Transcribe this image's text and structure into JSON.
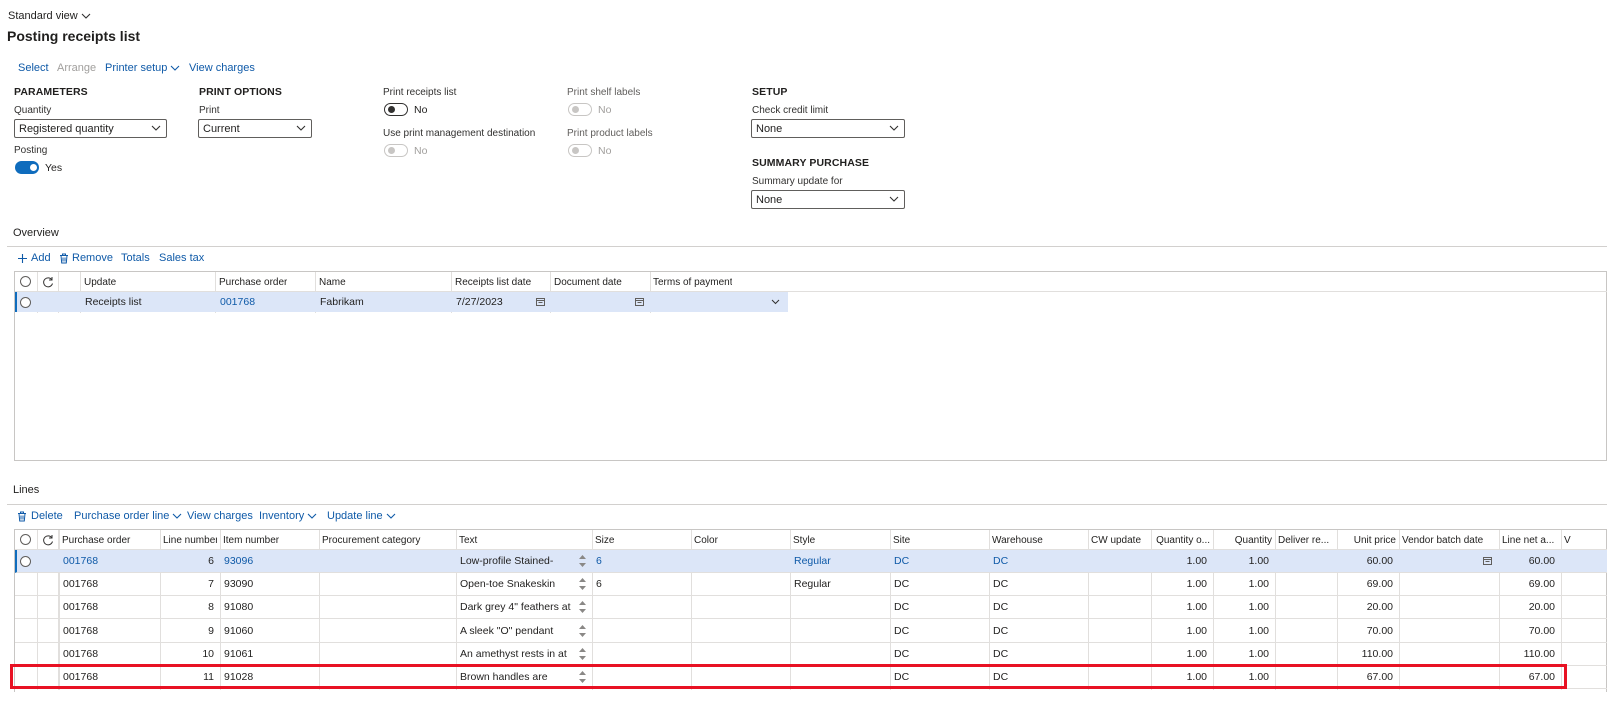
{
  "view": {
    "label": "Standard view"
  },
  "page_title": "Posting receipts list",
  "toolbar": {
    "select": "Select",
    "arrange": "Arrange",
    "printer_setup": "Printer setup",
    "view_charges": "View charges"
  },
  "parameters": {
    "heading": "PARAMETERS",
    "quantity_label": "Quantity",
    "quantity_value": "Registered quantity",
    "posting_label": "Posting",
    "posting_value": "Yes"
  },
  "print_options": {
    "heading": "PRINT OPTIONS",
    "print_label": "Print",
    "print_value": "Current",
    "print_receipts_list_label": "Print receipts list",
    "print_receipts_list_value": "No",
    "use_print_mgmt_label": "Use print management destination",
    "use_print_mgmt_value": "No",
    "print_shelf_labels_label": "Print shelf labels",
    "print_shelf_labels_value": "No",
    "print_product_labels_label": "Print product labels",
    "print_product_labels_value": "No"
  },
  "setup": {
    "heading": "SETUP",
    "check_credit_label": "Check credit limit",
    "check_credit_value": "None",
    "summary_heading": "SUMMARY PURCHASE",
    "summary_update_label": "Summary update for",
    "summary_update_value": "None"
  },
  "overview": {
    "heading": "Overview",
    "toolbar": {
      "add": "Add",
      "remove": "Remove",
      "totals": "Totals",
      "sales_tax": "Sales tax"
    },
    "columns": [
      "Update",
      "Purchase order",
      "Name",
      "Receipts list date",
      "Document date",
      "Terms of payment"
    ],
    "row": {
      "update": "Receipts list",
      "purchase_order": "001768",
      "name": "Fabrikam",
      "receipts_list_date": "7/27/2023",
      "document_date": "",
      "terms_of_payment": ""
    }
  },
  "lines": {
    "heading": "Lines",
    "toolbar": {
      "delete": "Delete",
      "purchase_order_line": "Purchase order line",
      "view_charges": "View charges",
      "inventory": "Inventory",
      "update_line": "Update line"
    },
    "columns": [
      "Purchase order",
      "Line number",
      "Item number",
      "Procurement category",
      "Text",
      "Size",
      "Color",
      "Style",
      "Site",
      "Warehouse",
      "CW update",
      "Quantity o...",
      "Quantity",
      "Deliver re...",
      "Unit price",
      "Vendor batch date",
      "Line net a...",
      "V"
    ],
    "rows": [
      {
        "po": "001768",
        "line": "6",
        "item": "93096",
        "cat": "",
        "text": "Low-profile Stained-",
        "size": "6",
        "color": "",
        "style": "Regular",
        "site": "DC",
        "wh": "DC",
        "cw": "",
        "qo": "1.00",
        "qty": "1.00",
        "dr": "",
        "price": "60.00",
        "vbd": "",
        "net": "60.00"
      },
      {
        "po": "001768",
        "line": "7",
        "item": "93090",
        "cat": "",
        "text": "Open-toe Snakeskin",
        "size": "6",
        "color": "",
        "style": "Regular",
        "site": "DC",
        "wh": "DC",
        "cw": "",
        "qo": "1.00",
        "qty": "1.00",
        "dr": "",
        "price": "69.00",
        "vbd": "",
        "net": "69.00"
      },
      {
        "po": "001768",
        "line": "8",
        "item": "91080",
        "cat": "",
        "text": "Dark grey 4\" feathers at",
        "size": "",
        "color": "",
        "style": "",
        "site": "DC",
        "wh": "DC",
        "cw": "",
        "qo": "1.00",
        "qty": "1.00",
        "dr": "",
        "price": "20.00",
        "vbd": "",
        "net": "20.00"
      },
      {
        "po": "001768",
        "line": "9",
        "item": "91060",
        "cat": "",
        "text": "A sleek \"O\" pendant",
        "size": "",
        "color": "",
        "style": "",
        "site": "DC",
        "wh": "DC",
        "cw": "",
        "qo": "1.00",
        "qty": "1.00",
        "dr": "",
        "price": "70.00",
        "vbd": "",
        "net": "70.00"
      },
      {
        "po": "001768",
        "line": "10",
        "item": "91061",
        "cat": "",
        "text": "An amethyst rests in at",
        "size": "",
        "color": "",
        "style": "",
        "site": "DC",
        "wh": "DC",
        "cw": "",
        "qo": "1.00",
        "qty": "1.00",
        "dr": "",
        "price": "110.00",
        "vbd": "",
        "net": "110.00"
      },
      {
        "po": "001768",
        "line": "11",
        "item": "91028",
        "cat": "",
        "text": "Brown handles are",
        "size": "",
        "color": "",
        "style": "",
        "site": "DC",
        "wh": "DC",
        "cw": "",
        "qo": "1.00",
        "qty": "1.00",
        "dr": "",
        "price": "67.00",
        "vbd": "",
        "net": "67.00"
      }
    ]
  },
  "colors": {
    "accent": "#0f6cbd",
    "link": "#0f5aa8",
    "selected_row": "#dce6f8",
    "highlight_border": "#e81123"
  }
}
